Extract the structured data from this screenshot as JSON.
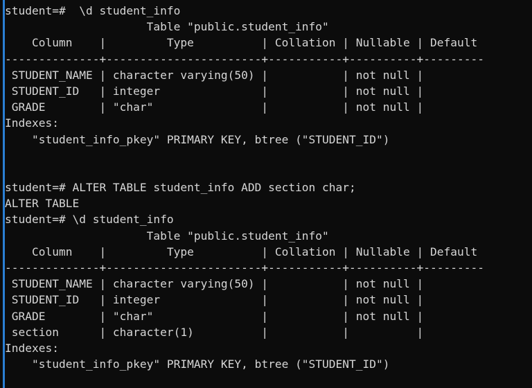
{
  "terminal": {
    "app": "psql-terminal",
    "background_color": "#0c0c0c",
    "text_color": "#d6d6d6",
    "accent_color": "#2a7fd4",
    "prompt": "student=#",
    "database": "student",
    "lines": [
      "student=#  \\d student_info",
      "                     Table \"public.student_info\"",
      "    Column    |         Type          | Collation | Nullable | Default ",
      "--------------+-----------------------+-----------+----------+---------",
      " STUDENT_NAME | character varying(50) |           | not null | ",
      " STUDENT_ID   | integer               |           | not null | ",
      " GRADE        | \"char\"                |           | not null | ",
      "Indexes:",
      "    \"student_info_pkey\" PRIMARY KEY, btree (\"STUDENT_ID\")",
      "",
      "",
      "student=# ALTER TABLE student_info ADD section char;",
      "ALTER TABLE",
      "student=# \\d student_info",
      "                     Table \"public.student_info\"",
      "    Column    |         Type          | Collation | Nullable | Default ",
      "--------------+-----------------------+-----------+----------+---------",
      " STUDENT_NAME | character varying(50) |           | not null | ",
      " STUDENT_ID   | integer               |           | not null | ",
      " GRADE        | \"char\"                |           | not null | ",
      " section      | character(1)          |           |          | ",
      "Indexes:",
      "    \"student_info_pkey\" PRIMARY KEY, btree (\"STUDENT_ID\")"
    ],
    "commands": [
      "\\d student_info",
      "ALTER TABLE student_info ADD section char;",
      "\\d student_info"
    ],
    "table_name": "public.student_info",
    "columns_header": [
      "Column",
      "Type",
      "Collation",
      "Nullable",
      "Default"
    ],
    "table_before": [
      {
        "column": "STUDENT_NAME",
        "type": "character varying(50)",
        "collation": "",
        "nullable": "not null",
        "default": ""
      },
      {
        "column": "STUDENT_ID",
        "type": "integer",
        "collation": "",
        "nullable": "not null",
        "default": ""
      },
      {
        "column": "GRADE",
        "type": "\"char\"",
        "collation": "",
        "nullable": "not null",
        "default": ""
      }
    ],
    "table_after": [
      {
        "column": "STUDENT_NAME",
        "type": "character varying(50)",
        "collation": "",
        "nullable": "not null",
        "default": ""
      },
      {
        "column": "STUDENT_ID",
        "type": "integer",
        "collation": "",
        "nullable": "not null",
        "default": ""
      },
      {
        "column": "GRADE",
        "type": "\"char\"",
        "collation": "",
        "nullable": "not null",
        "default": ""
      },
      {
        "column": "section",
        "type": "character(1)",
        "collation": "",
        "nullable": "",
        "default": ""
      }
    ],
    "indexes_label": "Indexes:",
    "index_definition": "\"student_info_pkey\" PRIMARY KEY, btree (\"STUDENT_ID\")",
    "alter_table_result": "ALTER TABLE"
  }
}
